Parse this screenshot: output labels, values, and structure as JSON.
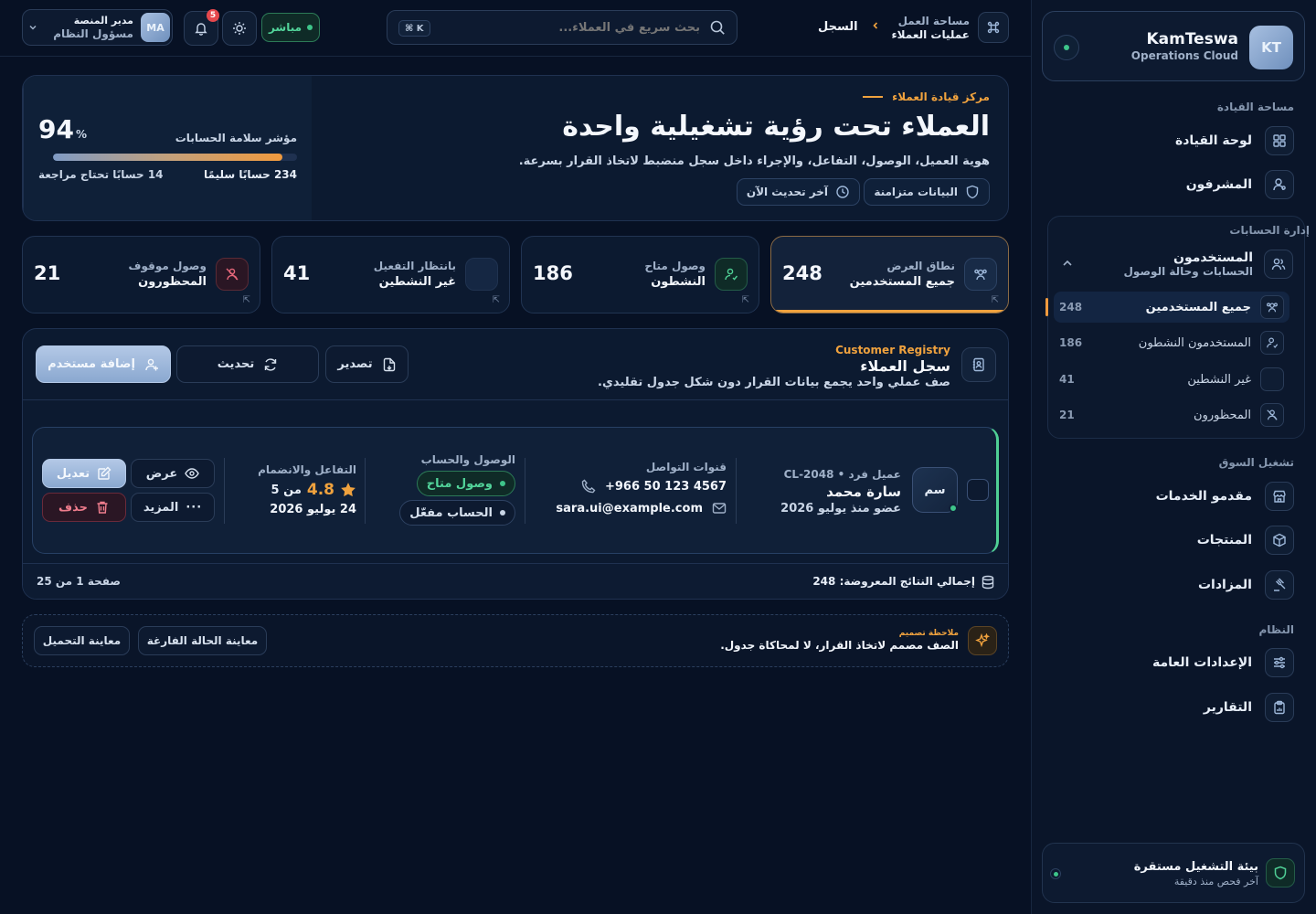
{
  "sidebar": {
    "brand": {
      "logo": "KT",
      "name": "KamTeswa",
      "sub": "Operations Cloud"
    },
    "sections": {
      "leadership": "مساحة القيادة",
      "accounts": "إدارة الحسابات",
      "market": "تشغيل السوق",
      "system": "النظام"
    },
    "leadership_items": [
      {
        "label": "لوحة القيادة",
        "icon": "grid-icon"
      },
      {
        "label": "المشرفون",
        "icon": "supervisor-icon"
      }
    ],
    "users_group": {
      "title": "المستخدمون",
      "sub": "الحسابات وحالة الوصول"
    },
    "user_subitems": [
      {
        "label": "جميع المستخدمين",
        "count": "248",
        "active": true
      },
      {
        "label": "المستخدمون النشطون",
        "count": "186"
      },
      {
        "label": "غير النشطين",
        "count": "41"
      },
      {
        "label": "المحظورون",
        "count": "21"
      }
    ],
    "market_items": [
      {
        "label": "مقدمو الخدمات",
        "icon": "store-icon"
      },
      {
        "label": "المنتجات",
        "icon": "box-icon"
      },
      {
        "label": "المزادات",
        "icon": "gavel-icon"
      }
    ],
    "system_items": [
      {
        "label": "الإعدادات العامة",
        "icon": "sliders-icon"
      },
      {
        "label": "التقارير",
        "icon": "clipboard-icon"
      }
    ],
    "env": {
      "title": "بيئة التشغيل مستقرة",
      "sub": "آخر فحص منذ دقيقة"
    }
  },
  "header": {
    "crumb_top": "مساحة العمل",
    "crumb_bottom": "عمليات العملاء",
    "crumb_current": "السجل",
    "search_placeholder": "بحث سريع في العملاء...",
    "kbd": "⌘ K",
    "live": "مباشر",
    "notifications": "5",
    "user": {
      "initials": "MA",
      "name": "مدير المنصة",
      "role": "مسؤول النظام"
    }
  },
  "hero": {
    "eyebrow": "مركز قيادة العملاء",
    "title": "العملاء تحت رؤية تشغيلية واحدة",
    "subtitle": "هوية العميل، الوصول، التفاعل، والإجراء داخل سجل منضبط لاتخاذ القرار بسرعة.",
    "pill_synced": "البيانات متزامنة",
    "pill_updated": "آخر تحديث الآن",
    "health_label": "مؤشر سلامة الحسابات",
    "health_value": "94",
    "health_unit": "%",
    "health_progress": 94,
    "healthy": "234 حسابًا سليمًا",
    "review": "14 حسابًا تحتاج مراجعة"
  },
  "stats": [
    {
      "l1": "نطاق العرض",
      "l2": "جميع المستخدمين",
      "num": "248",
      "icon": "users-icon",
      "active": true
    },
    {
      "l1": "وصول متاح",
      "l2": "النشطون",
      "num": "186",
      "icon": "user-check-icon"
    },
    {
      "l1": "بانتظار التفعيل",
      "l2": "غير النشطين",
      "num": "41",
      "icon": "user-pending-icon"
    },
    {
      "l1": "وصول موقوف",
      "l2": "المحظورون",
      "num": "21",
      "icon": "user-blocked-icon"
    }
  ],
  "registry": {
    "eyebrow": "Customer Registry",
    "title": "سجل العملاء",
    "subtitle": "صف عملي واحد يجمع بيانات القرار دون شكل جدول تقليدي.",
    "export": "تصدير",
    "refresh": "تحديث",
    "add": "إضافة مستخدم",
    "row": {
      "avatar": "سم",
      "meta": "عميل فرد • CL-2048",
      "name": "سارة محمد",
      "member": "عضو منذ يوليو 2026",
      "channels_label": "قنوات التواصل",
      "phone": "+966 50 123 4567",
      "email": "sara.ui@example.com",
      "access_label": "الوصول والحساب",
      "access_tag": "وصول متاح",
      "account_tag": "الحساب مفعّل",
      "engagement_label": "التفاعل والانضمام",
      "rating": "4.8",
      "rating_of": "من 5",
      "joined": "24 يوليو 2026",
      "view": "عرض",
      "edit": "تعديل",
      "more": "المزيد",
      "delete": "حذف"
    },
    "total": "إجمالي النتائج المعروضة: 248",
    "page": "صفحة 1 من 25"
  },
  "note": {
    "label": "ملاحظة تصميم",
    "text": "الصف مصمم لاتخاذ القرار، لا لمحاكاة جدول.",
    "empty": "معاينة الحالة الفارغة",
    "loading": "معاينة التحميل"
  },
  "colors": {
    "accent": "#f0a23e",
    "success": "#4fcf95",
    "danger": "#e5484d",
    "primary": "#8aa8d0"
  }
}
